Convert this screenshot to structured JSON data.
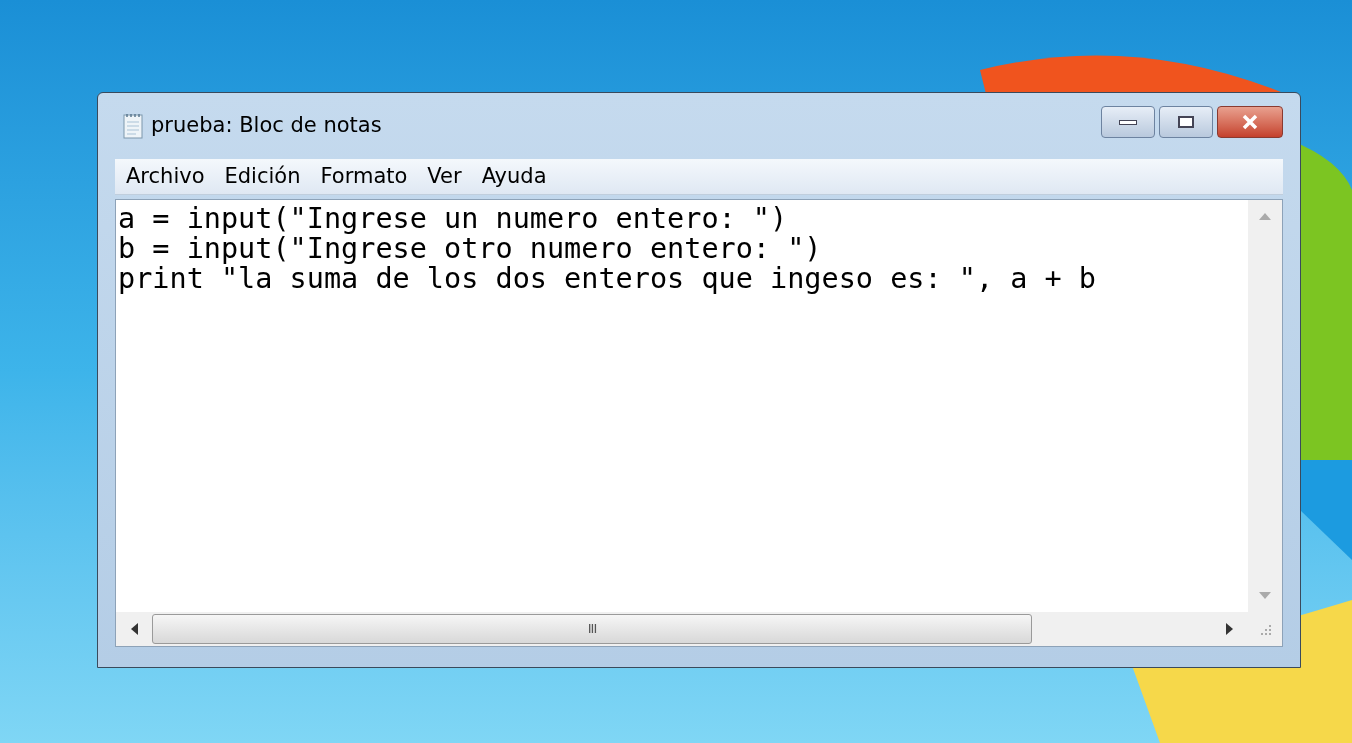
{
  "window": {
    "title": "prueba: Bloc de notas"
  },
  "menu": [
    "Archivo",
    "Edición",
    "Formato",
    "Ver",
    "Ayuda"
  ],
  "editor": {
    "lines": [
      "a = input(\"Ingrese un numero entero: \")",
      "b = input(\"Ingrese otro numero entero: \")",
      "print \"la suma de los dos enteros que ingeso es: \", a + b"
    ]
  },
  "scrollbar": {
    "grip": "III"
  }
}
